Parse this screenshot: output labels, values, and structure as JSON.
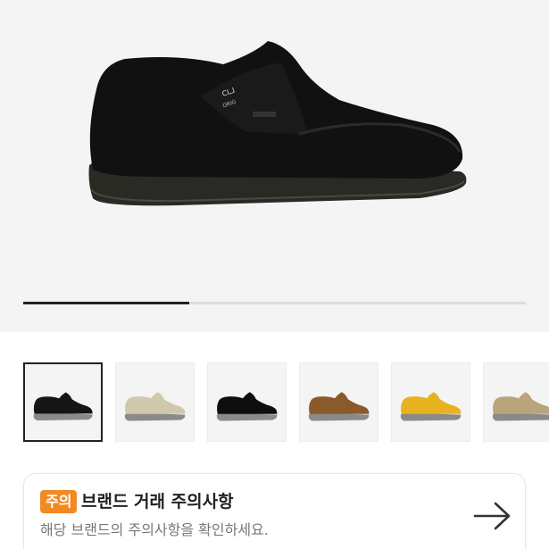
{
  "gallery": {
    "progress": 0.33,
    "thumbnails": [
      {
        "color": "#151515",
        "icon": "black-suede-shoe",
        "active": true
      },
      {
        "color": "#cfc8ad",
        "icon": "sand-suede-shoe",
        "active": false
      },
      {
        "color": "#0e0e0e",
        "icon": "black-suede-shoe-alt",
        "active": false
      },
      {
        "color": "#8a5a2b",
        "icon": "brown-leather-shoe",
        "active": false
      },
      {
        "color": "#e8b21e",
        "icon": "yellow-leather-shoe",
        "active": false
      },
      {
        "color": "#b9a47b",
        "icon": "beige-suede-shoe",
        "active": false
      }
    ]
  },
  "notice": {
    "badge": "주의",
    "title": "브랜드 거래 주의사항",
    "subtitle": "해당 브랜드의 주의사항을 확인하세요.",
    "arrow_icon": "arrow-right-icon",
    "badge_color": "#f28a24"
  }
}
